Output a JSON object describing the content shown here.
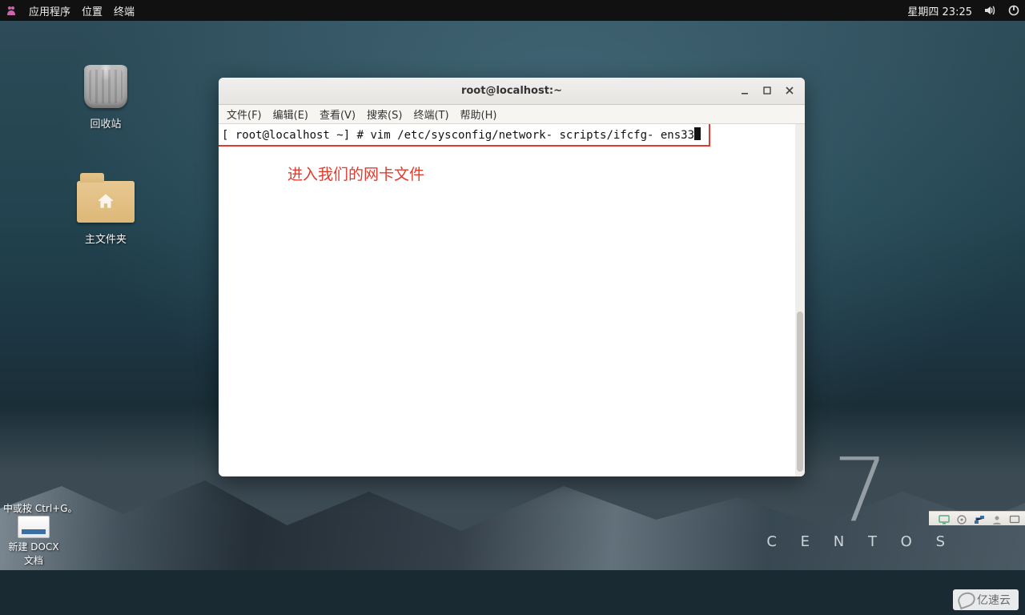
{
  "panel": {
    "applications": "应用程序",
    "places": "位置",
    "terminal": "终端",
    "datetime": "星期四 23:25"
  },
  "desktop_icons": {
    "trash": "回收站",
    "home": "主文件夹"
  },
  "branding": {
    "number": "7",
    "distro": "C E N T O S"
  },
  "terminal": {
    "title": "root@localhost:~",
    "menus": {
      "file": "文件(F)",
      "edit": "编辑(E)",
      "view": "查看(V)",
      "search": "搜索(S)",
      "terminal": "终端(T)",
      "help": "帮助(H)"
    },
    "prompt": "[ root@localhost ~] # ",
    "command": "vim /etc/sysconfig/network- scripts/ifcfg- ens33",
    "annotation": "进入我们的网卡文件"
  },
  "hint_bar": "中或按 Ctrl+G。",
  "doc_icon": {
    "line1": "新建 DOCX",
    "line2": "文档"
  },
  "watermark": "亿速云"
}
